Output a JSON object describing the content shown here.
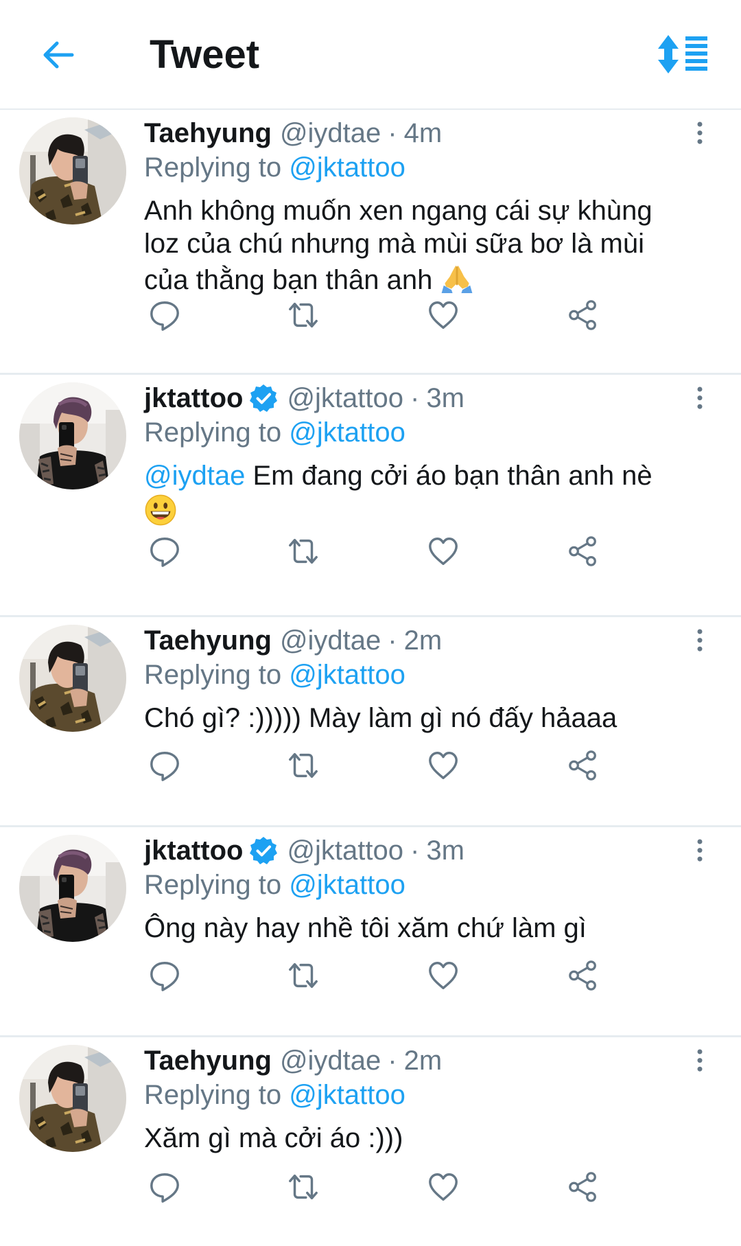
{
  "header": {
    "title": "Tweet",
    "back_icon": "arrow-left-icon",
    "sort_icon": "sort-order-icon"
  },
  "colors": {
    "accent": "#1da1f2",
    "text": "#14171a",
    "secondary": "#657786",
    "divider": "#e6ecf0"
  },
  "reply_prefix": "Replying to",
  "tweets": [
    {
      "name": "Taehyung",
      "handle": "@iydtae",
      "separator": "·",
      "time": "4m",
      "verified": false,
      "replying_to": "@jktattoo",
      "text_lines": [
        "Anh không muốn xen ngang cái sự khùng",
        "loz của chú nhưng mà mùi sữa bơ là mùi",
        "của thằng bạn thân anh"
      ],
      "emoji": "folded-hands-emoji"
    },
    {
      "name": "jktattoo",
      "handle": "@jktattoo",
      "separator": "·",
      "time": "3m",
      "verified": true,
      "replying_to": "@jktattoo",
      "mention": "@iydtae",
      "text": "Em đang cởi áo bạn thân anh nè",
      "emoji": "grinning-face-emoji"
    },
    {
      "name": "Taehyung",
      "handle": "@iydtae",
      "separator": "·",
      "time": "2m",
      "verified": false,
      "replying_to": "@jktattoo",
      "text": "Chó gì? :))))) Mày làm gì nó đấy hảaaa"
    },
    {
      "name": "jktattoo",
      "handle": "@jktattoo",
      "separator": "·",
      "time": "3m",
      "verified": true,
      "replying_to": "@jktattoo",
      "text": "Ông này hay nhề tôi xăm chứ làm gì"
    },
    {
      "name": "Taehyung",
      "handle": "@iydtae",
      "separator": "·",
      "time": "2m",
      "verified": false,
      "replying_to": "@jktattoo",
      "text": "Xăm gì mà cởi áo :)))"
    }
  ],
  "action_icons": [
    "reply-icon",
    "retweet-icon",
    "like-icon",
    "share-icon"
  ]
}
